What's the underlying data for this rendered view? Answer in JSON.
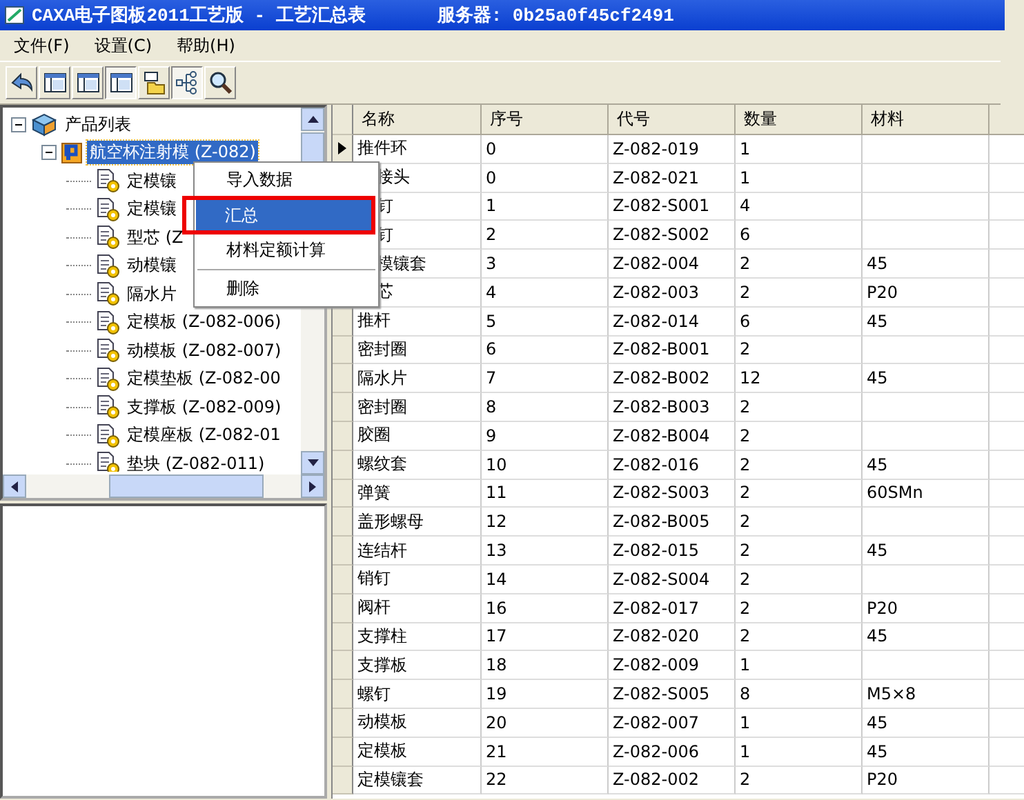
{
  "window": {
    "title": "CAXA电子图板2011工艺版 - 工艺汇总表",
    "server": "服务器: 0b25a0f45cf2491"
  },
  "menu_bar": [
    "文件(F)",
    "设置(C)",
    "帮助(H)"
  ],
  "toolbar": [
    {
      "kind": "back",
      "pressed": false
    },
    {
      "kind": "panel",
      "pressed": false
    },
    {
      "kind": "panel",
      "pressed": false
    },
    {
      "kind": "panel",
      "pressed": true
    },
    {
      "kind": "folder",
      "pressed": false
    },
    {
      "kind": "tree",
      "pressed": true
    },
    {
      "kind": "search",
      "pressed": false
    }
  ],
  "tree": {
    "label": "产品列表",
    "expanded": true,
    "children": [
      {
        "label": "航空杯注射模 (Z-082)",
        "selected": true,
        "expanded": true,
        "children": [
          {
            "label": "定模镶"
          },
          {
            "label": "定模镶"
          },
          {
            "label": "型芯 (Z"
          },
          {
            "label": "动模镶"
          },
          {
            "label": "隔水片"
          },
          {
            "label": "定模板 (Z-082-006)"
          },
          {
            "label": "动模板 (Z-082-007)"
          },
          {
            "label": "定模垫板 (Z-082-00"
          },
          {
            "label": "支撑板 (Z-082-009)"
          },
          {
            "label": "定模座板 (Z-082-01"
          },
          {
            "label": "垫块 (Z-082-011)"
          }
        ]
      }
    ]
  },
  "context_menu": [
    {
      "label": "导入数据",
      "selected": false
    },
    {
      "label": "汇总",
      "selected": true
    },
    {
      "label": "材料定额计算",
      "selected": false
    },
    {
      "label": "删除",
      "selected": false
    }
  ],
  "table": {
    "columns": [
      "名称",
      "序号",
      "代号",
      "数量",
      "材料"
    ],
    "rows": [
      {
        "current": true,
        "under_menu": false,
        "cells": [
          "推件环",
          "0",
          "Z-082-019",
          "1",
          ""
        ]
      },
      {
        "under_menu": true,
        "cells": [
          "接头",
          "0",
          "Z-082-021",
          "1",
          ""
        ]
      },
      {
        "under_menu": true,
        "cells": [
          "钉",
          "1",
          "Z-082-S001",
          "4",
          ""
        ]
      },
      {
        "under_menu": true,
        "cells": [
          "钉",
          "2",
          "Z-082-S002",
          "6",
          ""
        ]
      },
      {
        "under_menu": true,
        "cells": [
          "模镶套",
          "3",
          "Z-082-004",
          "2",
          "45"
        ]
      },
      {
        "under_menu": true,
        "cells": [
          "芯",
          "4",
          "Z-082-003",
          "2",
          "P20"
        ]
      },
      {
        "current": false,
        "under_menu": false,
        "cells": [
          "推杆",
          "5",
          "Z-082-014",
          "6",
          "45"
        ]
      },
      {
        "current": false,
        "under_menu": false,
        "cells": [
          "密封圈",
          "6",
          "Z-082-B001",
          "2",
          ""
        ]
      },
      {
        "current": false,
        "under_menu": false,
        "cells": [
          "隔水片",
          "7",
          "Z-082-B002",
          "12",
          "45"
        ]
      },
      {
        "current": false,
        "under_menu": false,
        "cells": [
          "密封圈",
          "8",
          "Z-082-B003",
          "2",
          ""
        ]
      },
      {
        "current": false,
        "under_menu": false,
        "cells": [
          "胶圈",
          "9",
          "Z-082-B004",
          "2",
          ""
        ]
      },
      {
        "current": false,
        "under_menu": false,
        "cells": [
          "螺纹套",
          "10",
          "Z-082-016",
          "2",
          "45"
        ]
      },
      {
        "current": false,
        "under_menu": false,
        "cells": [
          "弹簧",
          "11",
          "Z-082-S003",
          "2",
          "60SMn"
        ]
      },
      {
        "current": false,
        "under_menu": false,
        "cells": [
          "盖形螺母",
          "12",
          "Z-082-B005",
          "2",
          ""
        ]
      },
      {
        "current": false,
        "under_menu": false,
        "cells": [
          "连结杆",
          "13",
          "Z-082-015",
          "2",
          "45"
        ]
      },
      {
        "current": false,
        "under_menu": false,
        "cells": [
          "销钉",
          "14",
          "Z-082-S004",
          "2",
          ""
        ]
      },
      {
        "current": false,
        "under_menu": false,
        "cells": [
          "阀杆",
          "16",
          "Z-082-017",
          "2",
          "P20"
        ]
      },
      {
        "current": false,
        "under_menu": false,
        "cells": [
          "支撑柱",
          "17",
          "Z-082-020",
          "2",
          "45"
        ]
      },
      {
        "current": false,
        "under_menu": false,
        "cells": [
          "支撑板",
          "18",
          "Z-082-009",
          "1",
          ""
        ]
      },
      {
        "current": false,
        "under_menu": false,
        "cells": [
          "螺钉",
          "19",
          "Z-082-S005",
          "8",
          "M5×8"
        ]
      },
      {
        "current": false,
        "under_menu": false,
        "cells": [
          "动模板",
          "20",
          "Z-082-007",
          "1",
          "45"
        ]
      },
      {
        "current": false,
        "under_menu": false,
        "cells": [
          "定模板",
          "21",
          "Z-082-006",
          "1",
          "45"
        ]
      },
      {
        "current": false,
        "under_menu": false,
        "cells": [
          "定模镶套",
          "22",
          "Z-082-002",
          "2",
          "P20"
        ]
      }
    ]
  }
}
